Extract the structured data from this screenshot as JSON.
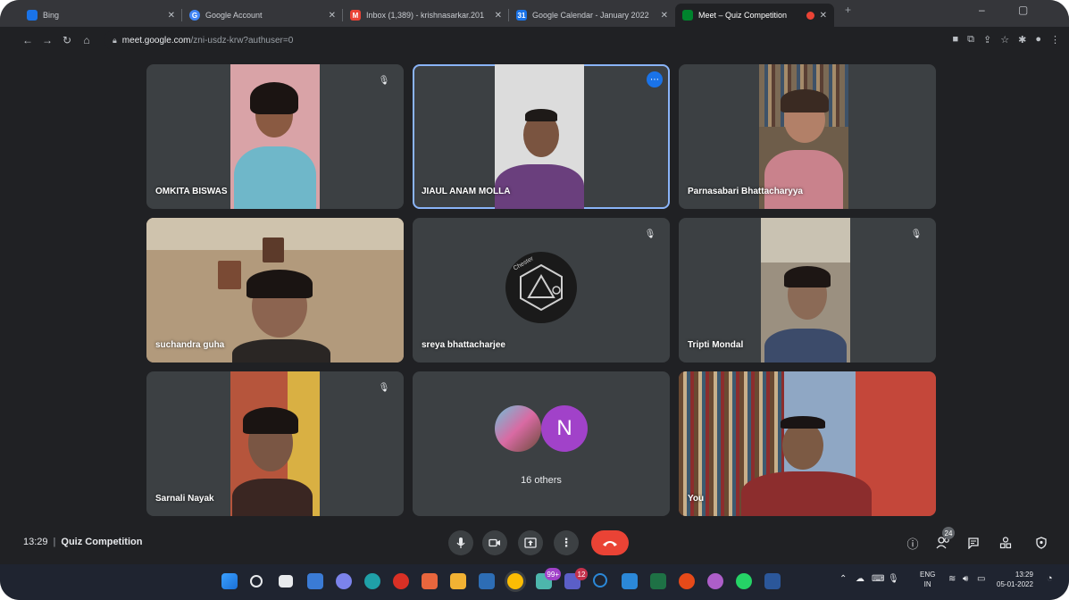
{
  "browser": {
    "tabs": [
      {
        "title": "Bing",
        "fav_color": "#1a73e8",
        "active": false
      },
      {
        "title": "Google Account",
        "fav_color": "#4285f4",
        "active": false
      },
      {
        "title": "Inbox (1,389) - krishnasarkar.201",
        "fav_color": "#ea4335",
        "active": false
      },
      {
        "title": "Google Calendar - January 2022",
        "fav_color": "#1a73e8",
        "active": false
      },
      {
        "title": "Meet – Quiz Competition",
        "fav_color": "#00832d",
        "active": true
      }
    ],
    "url_host": "meet.google.com",
    "url_path": "/zni-usdz-krw?authuser=0"
  },
  "participants": [
    {
      "name": "OMKITA BISWAS",
      "muted": true,
      "bg": "#c98a8a",
      "shirt": "#6fb7c9",
      "skin": "#8a5a42",
      "hair": "#1b1412"
    },
    {
      "name": "JIAUL ANAM MOLLA",
      "muted": false,
      "speaking": true,
      "bg": "#d9d9d9",
      "shirt": "#6a3f7d",
      "skin": "#7a5440",
      "hair": "#1e1a18"
    },
    {
      "name": "Parnasabari Bhattacharyya",
      "muted": false,
      "bg": "#8a7560",
      "shirt": "#c9828c",
      "skin": "#b28068",
      "hair": "#3a2a22"
    },
    {
      "name": "suchandra guha",
      "muted": false,
      "bg": "#a98e6f",
      "shirt": "#2a2624",
      "skin": "#8c6450",
      "hair": "#1a1412"
    },
    {
      "name": "sreya bhattacharjee",
      "muted": true,
      "avatar_label": "Chester"
    },
    {
      "name": "Tripti Mondal",
      "muted": true,
      "bg": "#9b9080",
      "shirt": "#3c4b6a",
      "skin": "#8b6a56",
      "hair": "#1d1614"
    },
    {
      "name": "Sarnali Nayak",
      "muted": true,
      "bg": "#b6553c",
      "shirt": "#3a2622",
      "skin": "#7a5644",
      "hair": "#1a1412"
    },
    {
      "name": "16 others",
      "others": true,
      "avatar_letter": "N",
      "avatar_color": "#a142c9"
    },
    {
      "name": "You",
      "muted": false,
      "bg": "#c4473a",
      "shirt": "#8c2d2d",
      "skin": "#7c5a44",
      "hair": "#1a1414"
    }
  ],
  "meeting": {
    "time": "13:29",
    "title": "Quiz Competition",
    "people_count": "24"
  },
  "taskbar": {
    "lang_top": "ENG",
    "lang_bottom": "IN",
    "clock_time": "13:29",
    "clock_date": "05-01-2022",
    "whatsapp_badge": "99+",
    "teams_badge": "12"
  }
}
